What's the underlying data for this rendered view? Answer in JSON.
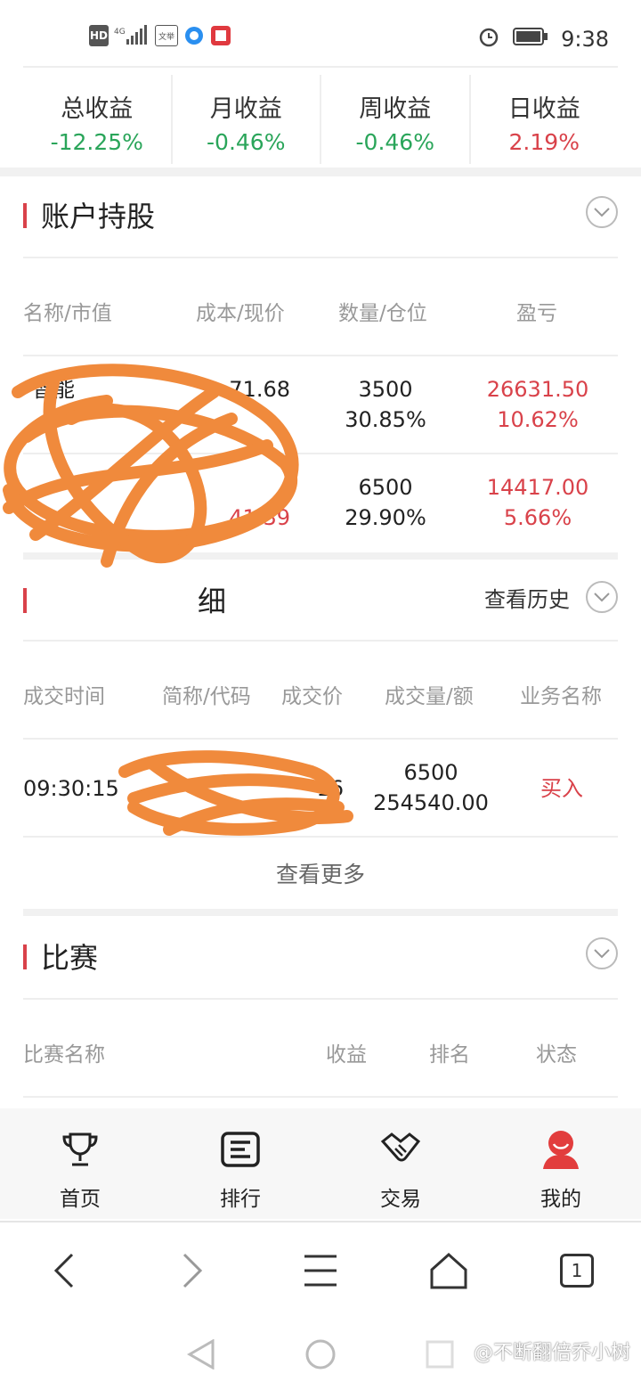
{
  "status_bar": {
    "left_icons": [
      "HD",
      "4G",
      "文举"
    ],
    "time": "9:38"
  },
  "stats": [
    {
      "label": "总收益",
      "value": "-12.25%",
      "tone": "green"
    },
    {
      "label": "月收益",
      "value": "-0.46%",
      "tone": "green"
    },
    {
      "label": "周收益",
      "value": "-0.46%",
      "tone": "green"
    },
    {
      "label": "日收益",
      "value": "2.19%",
      "tone": "red"
    }
  ],
  "holdings": {
    "title": "账户持股",
    "columns": [
      "名称/市值",
      "成本/现价",
      "数量/仓位",
      "盈亏"
    ],
    "rows": [
      {
        "name": "智能",
        "cost": "71.68",
        "price": "",
        "qty": "3500",
        "pos": "30.85%",
        "pl": "26631.50",
        "pl_pct": "10.62%"
      },
      {
        "name": "",
        "cost": "",
        "price": "41.39",
        "qty": "6500",
        "pos": "29.90%",
        "pl": "14417.00",
        "pl_pct": "5.66%"
      }
    ]
  },
  "trades": {
    "title": "细",
    "history_label": "查看历史",
    "columns": [
      "成交时间",
      "简称/代码",
      "成交价",
      "成交量/额",
      "业务名称"
    ],
    "rows": [
      {
        "time": "09:30:15",
        "price": "16",
        "qty": "6500",
        "amount": "254540.00",
        "action": "买入"
      }
    ],
    "more_label": "查看更多"
  },
  "contest": {
    "title": "比赛",
    "columns": [
      "比赛名称",
      "收益",
      "排名",
      "状态"
    ]
  },
  "tabs": [
    {
      "label": "首页",
      "icon": "trophy-icon"
    },
    {
      "label": "排行",
      "icon": "list-icon"
    },
    {
      "label": "交易",
      "icon": "handshake-icon"
    },
    {
      "label": "我的",
      "icon": "user-icon",
      "active": true
    }
  ],
  "browser_tab_count": "1",
  "watermark": "@不断翻倍乔小树",
  "colors": {
    "accent": "#d9424a",
    "gain": "#d9424a",
    "loss": "#2aa55a",
    "scribble": "#f08a3c"
  }
}
